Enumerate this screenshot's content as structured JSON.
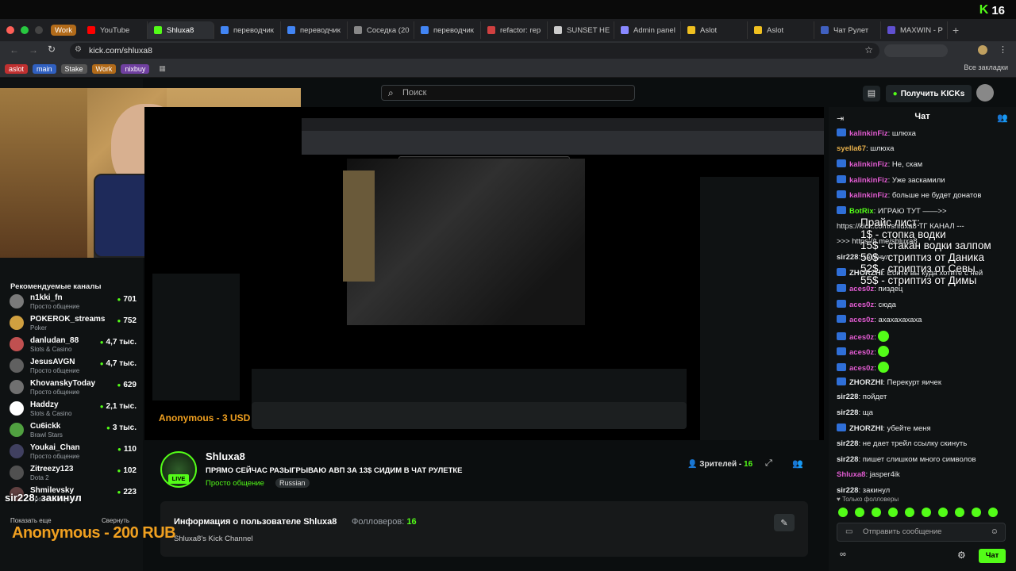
{
  "overlay": {
    "kick_logo": "K",
    "viewer_count": "16"
  },
  "browser": {
    "tabs": [
      {
        "label": "Work",
        "color": "#b26b1a",
        "kind": "group"
      },
      {
        "label": "YouTube",
        "color": "#ff0000"
      },
      {
        "label": "Shluxa8",
        "color": "#53fc18",
        "active": true
      },
      {
        "label": "переводчик",
        "color": "#4285f4"
      },
      {
        "label": "переводчик",
        "color": "#4285f4"
      },
      {
        "label": "Соседка (20",
        "color": "#888888"
      },
      {
        "label": "переводчик",
        "color": "#4285f4"
      },
      {
        "label": "refactor: rep",
        "color": "#d04040"
      },
      {
        "label": "SUNSET HE",
        "color": "#cccccc"
      },
      {
        "label": "Admin panel",
        "color": "#8888ff"
      },
      {
        "label": "Aslot",
        "color": "#f0c020"
      },
      {
        "label": "Aslot",
        "color": "#f0c020"
      },
      {
        "label": "Чат Рулет",
        "color": "#4060c0"
      },
      {
        "label": "MAXWIN - P",
        "color": "#6050d0"
      }
    ],
    "url": "kick.com/shluxa8",
    "bookmarks": [
      {
        "label": "aslot",
        "color": "#c03030"
      },
      {
        "label": "main",
        "color": "#3060c0"
      },
      {
        "label": "Stake",
        "color": "#555555"
      },
      {
        "label": "Work",
        "color": "#b26b1a"
      },
      {
        "label": "nixbuy",
        "color": "#7040a0"
      }
    ],
    "all_bookmarks": "Все закладки"
  },
  "header": {
    "search_placeholder": "Поиск",
    "get_kicks": "Получить KICKs"
  },
  "sidebar": {
    "recommended_title": "Рекомендуемые каналы",
    "channels": [
      {
        "name": "n1kki_fn",
        "category": "Просто общение",
        "viewers": "701",
        "color": "#7a7a7a"
      },
      {
        "name": "POKEROK_streams",
        "category": "Poker",
        "viewers": "752",
        "color": "#d0a040"
      },
      {
        "name": "danludan_88",
        "category": "Slots & Casino",
        "viewers": "4,7 тыс.",
        "color": "#c05050"
      },
      {
        "name": "JesusAVGN",
        "category": "Просто общение",
        "viewers": "4,7 тыс.",
        "color": "#606060"
      },
      {
        "name": "KhovanskyToday",
        "category": "Просто общение",
        "viewers": "629",
        "color": "#707070"
      },
      {
        "name": "Haddzy",
        "category": "Slots & Casino",
        "viewers": "2,1 тыс.",
        "color": "#ffffff"
      },
      {
        "name": "Cu6ickk",
        "category": "Brawl Stars",
        "viewers": "3 тыс.",
        "color": "#50a040"
      },
      {
        "name": "Youkai_Chan",
        "category": "Просто общение",
        "viewers": "110",
        "color": "#404060"
      },
      {
        "name": "Zitreezy123",
        "category": "Dota 2",
        "viewers": "102",
        "color": "#505050"
      },
      {
        "name": "Shmilevsky",
        "category": "Просто общение",
        "viewers": "223",
        "color": "#604040"
      }
    ],
    "show_more": "Показать еще",
    "collapse": "Свернуть"
  },
  "stream": {
    "streamer": "Shluxa8",
    "live": "LIVE",
    "title": "ПРЯМО СЕЙЧАС РАЗЫГРЫВАЮ АВП ЗА 13$ СИДИМ В ЧАТ РУЛЕТКЕ",
    "category": "Просто общение",
    "language": "Russian",
    "viewers_label": "Зрителей -",
    "viewers": "16"
  },
  "about": {
    "title": "Информация о пользователе Shluxa8",
    "followers_label": "Фолловеров:",
    "followers": "16",
    "description": "Shluxa8's Kick Channel"
  },
  "overlays": {
    "donation_big": "Anonymous - 200 RUB",
    "donation_small": "Anonymous - 3 USD",
    "sir_text": "sir228: закинул",
    "pricelist": [
      "Прайс лист:",
      "1$ - стопка водки",
      "15$ - стакан водки залпом",
      "50$ - стриптиз от Даника",
      "52$ - стриптиз от Севы",
      "55$ - стриптиз от Димы"
    ]
  },
  "chat": {
    "title": "Чат",
    "messages": [
      {
        "user": "kalinkinFiz",
        "text": ": шлюха",
        "color": "#e05bd0",
        "badge": true
      },
      {
        "user": "syella67",
        "text": ": шлюха",
        "color": "#e7b04b",
        "badge": false
      },
      {
        "user": "kalinkinFiz",
        "text": ": Не, скам",
        "color": "#e05bd0",
        "badge": true
      },
      {
        "user": "kalinkinFiz",
        "text": ": Уже заскамили",
        "color": "#e05bd0",
        "badge": true
      },
      {
        "user": "kalinkinFiz",
        "text": ": больше не будет донатов",
        "color": "#e05bd0",
        "badge": true
      },
      {
        "user": "BotRix",
        "text": ": ИГРАЮ ТУТ ——>>",
        "color": "#53fc18",
        "badge": true
      },
      {
        "user": "",
        "text": "https://kick.com/shluxa8 ТГ КАНАЛ ---",
        "color": "#e7e9ea",
        "badge": false
      },
      {
        "user": "",
        "text": ">>> https://t.me/shluxa8",
        "color": "#e7e9ea",
        "badge": false
      },
      {
        "user": "sir228",
        "text": ": закинул",
        "color": "#e7e9ea",
        "badge": false
      },
      {
        "user": "ZHORZHI",
        "text": ": Ебите вы куда хотите с ней",
        "color": "#e7e9ea",
        "badge": true
      },
      {
        "user": "aces0z",
        "text": ": пиздец",
        "color": "#e05bd0",
        "badge": true
      },
      {
        "user": "aces0z",
        "text": ": сюда",
        "color": "#e05bd0",
        "badge": true
      },
      {
        "user": "aces0z",
        "text": ": ахахахахаха",
        "color": "#e05bd0",
        "badge": true
      },
      {
        "user": "aces0z",
        "text": ":",
        "color": "#e05bd0",
        "badge": true,
        "emote": true
      },
      {
        "user": "aces0z",
        "text": ":",
        "color": "#e05bd0",
        "badge": true,
        "emote": true
      },
      {
        "user": "aces0z",
        "text": ":",
        "color": "#e05bd0",
        "badge": true,
        "emote": true
      },
      {
        "user": "ZHORZHI",
        "text": ": Перекурт яичек",
        "color": "#e7e9ea",
        "badge": true
      },
      {
        "user": "sir228",
        "text": ": пойдет",
        "color": "#e7e9ea",
        "badge": false
      },
      {
        "user": "sir228",
        "text": ": ща",
        "color": "#e7e9ea",
        "badge": false
      },
      {
        "user": "ZHORZHI",
        "text": ": убейте меня",
        "color": "#e7e9ea",
        "badge": true
      },
      {
        "user": "sir228",
        "text": ": не дает трейл ссылку скинуть",
        "color": "#e7e9ea",
        "badge": false
      },
      {
        "user": "sir228",
        "text": ": пишет слишком много символов",
        "color": "#e7e9ea",
        "badge": false
      },
      {
        "user": "Shluxa8",
        "text": ": jasper4ik",
        "color": "#e05bd0",
        "badge": false
      },
      {
        "user": "sir228",
        "text": ": закинул",
        "color": "#e7e9ea",
        "badge": false
      }
    ],
    "followers_only": "Только фолловеры",
    "input_placeholder": "Отправить сообщение",
    "send": "Чат"
  }
}
